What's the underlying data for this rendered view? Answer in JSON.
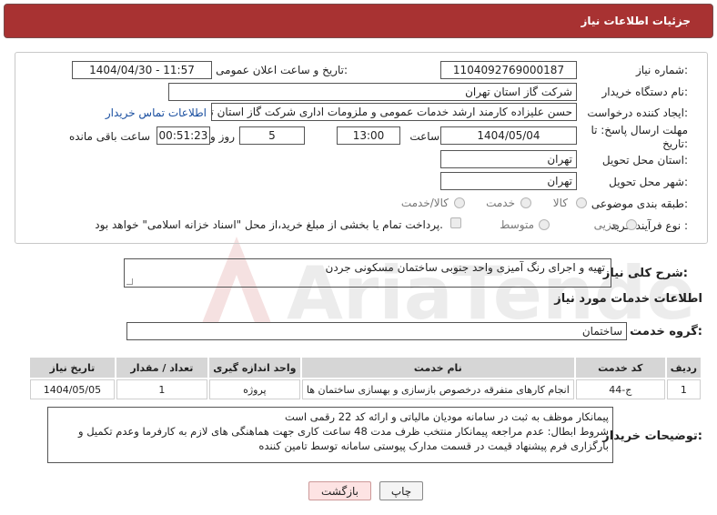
{
  "header": {
    "title": "جزئیات اطلاعات نیاز"
  },
  "form": {
    "need_number_label": "شماره نیاز:",
    "need_number": "1104092769000187",
    "announce_label": "تاریخ و ساعت اعلان عمومی:",
    "announce_value": "1404/04/30 - 11:57",
    "buyer_org_label": "نام دستگاه خریدار:",
    "buyer_org": "شرکت گاز استان تهران",
    "requester_label": "ایجاد کننده درخواست:",
    "requester": "حسن علیزاده کارمند ارشد خدمات عمومی و ملزومات اداری شرکت گاز استان تهران",
    "contact_link": "اطلاعات تماس خریدار",
    "deadline_label": "مهلت ارسال پاسخ: تا تاریخ:",
    "deadline_date": "1404/05/04",
    "time_label": "ساعت",
    "deadline_time": "13:00",
    "days_value": "5",
    "days_label": "روز و",
    "remaining_value": "00:51:23",
    "remaining_label": "ساعت باقی مانده",
    "province_label": "استان محل تحویل:",
    "province": "تهران",
    "city_label": "شهر محل تحویل:",
    "city": "تهران",
    "category_label": "طبقه بندی موضوعی:",
    "category_options": [
      "کالا",
      "خدمت",
      "کالا/خدمت"
    ],
    "process_label": "نوع فرآیند خرید :",
    "process_options": [
      "جزیی",
      "متوسط"
    ],
    "payment_note": "پرداخت تمام یا بخشی از مبلغ خرید،از محل \"اسناد خزانه اسلامی\" خواهد بود."
  },
  "summary": {
    "label": "شرح کلی نیاز:",
    "text": "تهیه و اجرای رنگ آمیزی واحد جنوبی ساختمان مسکونی جردن"
  },
  "services": {
    "section_title": "اطلاعات خدمات مورد نیاز",
    "group_label": "گروه خدمت:",
    "group_value": "ساختمان",
    "columns": [
      "ردیف",
      "کد خدمت",
      "نام خدمت",
      "واحد اندازه گیری",
      "تعداد / مقدار",
      "تاریخ نیاز"
    ],
    "rows": [
      [
        "1",
        "ج-44",
        "انجام کارهای متفرقه درخصوص بازسازی و بهسازی ساختمان ها",
        "پروژه",
        "1",
        "1404/05/05"
      ]
    ]
  },
  "buyer_notes": {
    "label": "توضیحات خریدار:",
    "lines": [
      "پیمانکار موظف به ثبت در سامانه مودیان مالیاتی و ارائه کد 22 رقمی است",
      "شروط ابطال: عدم مراجعه پیمانکار منتخب ظرف مدت 48 ساعت کاری جهت هماهنگی های لازم به کارفرما وعدم تکمیل و",
      "بارگزاری فرم پیشنهاد قیمت در قسمت مدارک پیوستی سامانه توسط تامین کننده"
    ]
  },
  "buttons": {
    "print": "چاپ",
    "back": "بازگشت"
  },
  "watermark": "AriaTender.neT"
}
